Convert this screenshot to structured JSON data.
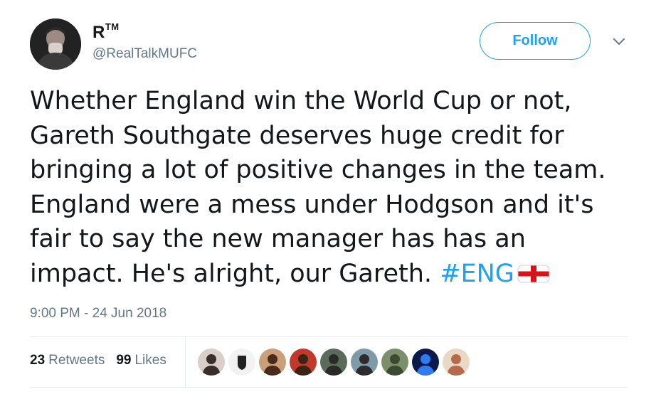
{
  "user": {
    "display_name": "R",
    "trademark": "TM",
    "handle": "@RealTalkMUFC",
    "avatar_icon": "profile-photo-icon"
  },
  "actions": {
    "follow_label": "Follow",
    "menu_icon": "chevron-down-icon"
  },
  "tweet": {
    "lines": [
      "Whether England win the World Cup or not,",
      "Gareth Southgate deserves huge credit for",
      "bringing a lot of positive changes in the team.",
      "England were a mess under Hodgson and it's",
      "fair to say the new manager has has an",
      "impact. He's alright, our Gareth. "
    ],
    "hashtag": "#ENG",
    "emoji": "england-flag-icon"
  },
  "timestamp": "9:00 PM - 24 Jun 2018",
  "stats": {
    "retweets_count": "23",
    "retweets_label": "Retweets",
    "likes_count": "99",
    "likes_label": "Likes"
  },
  "likers": [
    {
      "name": "liker-avatar-1",
      "bg": "#d9cfc8",
      "fg": "#3a2e2a"
    },
    {
      "name": "liker-avatar-2",
      "bg": "#f2f2f2",
      "fg": "#222222"
    },
    {
      "name": "liker-avatar-3",
      "bg": "#c9a07a",
      "fg": "#4a2a18"
    },
    {
      "name": "liker-avatar-4",
      "bg": "#c0392b",
      "fg": "#3b2416"
    },
    {
      "name": "liker-avatar-5",
      "bg": "#5b6b5a",
      "fg": "#2a2a2a"
    },
    {
      "name": "liker-avatar-6",
      "bg": "#7f9aa8",
      "fg": "#2c2c2c"
    },
    {
      "name": "liker-avatar-7",
      "bg": "#7b8f6a",
      "fg": "#3d4a32"
    },
    {
      "name": "liker-avatar-8",
      "bg": "#0b1a4a",
      "fg": "#2f7cf0"
    },
    {
      "name": "liker-avatar-9",
      "bg": "#e9d9c4",
      "fg": "#b56a4a"
    }
  ],
  "colors": {
    "accent": "#1da1f2",
    "text": "#14171a",
    "muted": "#657786",
    "divider": "#e6ecf0"
  }
}
